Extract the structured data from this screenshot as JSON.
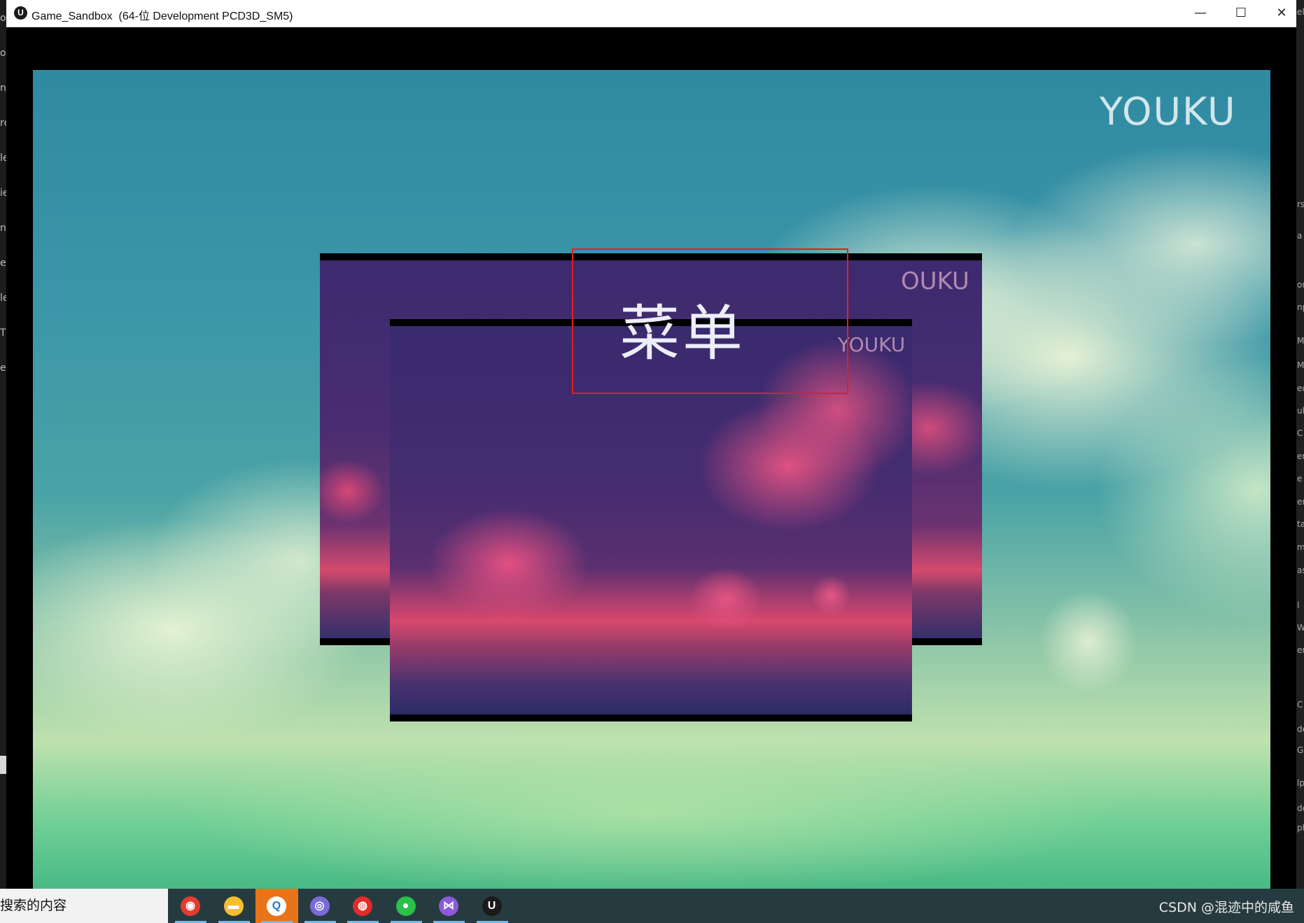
{
  "window": {
    "title": "Game_Sandbox  (64-位 Development PCD3D_SM5)",
    "minimize_glyph": "—",
    "maximize_glyph": "☐",
    "close_glyph": "✕"
  },
  "game": {
    "watermark_main": "YOUKU",
    "watermark_panel_back": "OUKU",
    "watermark_panel_front": "YOUKU",
    "menu_title": "菜单",
    "highlight_color": "#e02020"
  },
  "left_strip": [
    "ot",
    "ot",
    "nt",
    "re",
    "le",
    "ie",
    "n",
    "e",
    "le",
    "T",
    "e"
  ],
  "right_strip": [
    "el",
    "rs",
    "a",
    "on",
    "np",
    "M",
    "Mc",
    "ed",
    "ul",
    "C",
    "er",
    "e",
    "er",
    "ta",
    "m",
    "as",
    "l",
    "W",
    "er",
    "C",
    "de",
    "G",
    "lp",
    "de",
    "ph"
  ],
  "taskbar": {
    "search_text": "搜索的内容",
    "apps": [
      {
        "name": "chrome-icon",
        "color": "#e33b2e",
        "glyph": "◉",
        "state": "running"
      },
      {
        "name": "file-explorer-icon",
        "color": "#f5c02a",
        "glyph": "▬",
        "state": "running"
      },
      {
        "name": "search-app-icon",
        "color": "#ffffff",
        "glyph": "Q",
        "state": "active"
      },
      {
        "name": "app-purple-icon",
        "color": "#7b6bd6",
        "glyph": "◎",
        "state": "running"
      },
      {
        "name": "netease-music-icon",
        "color": "#e22b2b",
        "glyph": "◍",
        "state": "running"
      },
      {
        "name": "wechat-icon",
        "color": "#2ac04a",
        "glyph": "●",
        "state": "running"
      },
      {
        "name": "visual-studio-icon",
        "color": "#8b5bd9",
        "glyph": "⋈",
        "state": "running"
      },
      {
        "name": "unreal-engine-icon",
        "color": "#1a1a1a",
        "glyph": "U",
        "state": "running"
      }
    ],
    "watermark": "CSDN @混迹中的咸鱼"
  }
}
